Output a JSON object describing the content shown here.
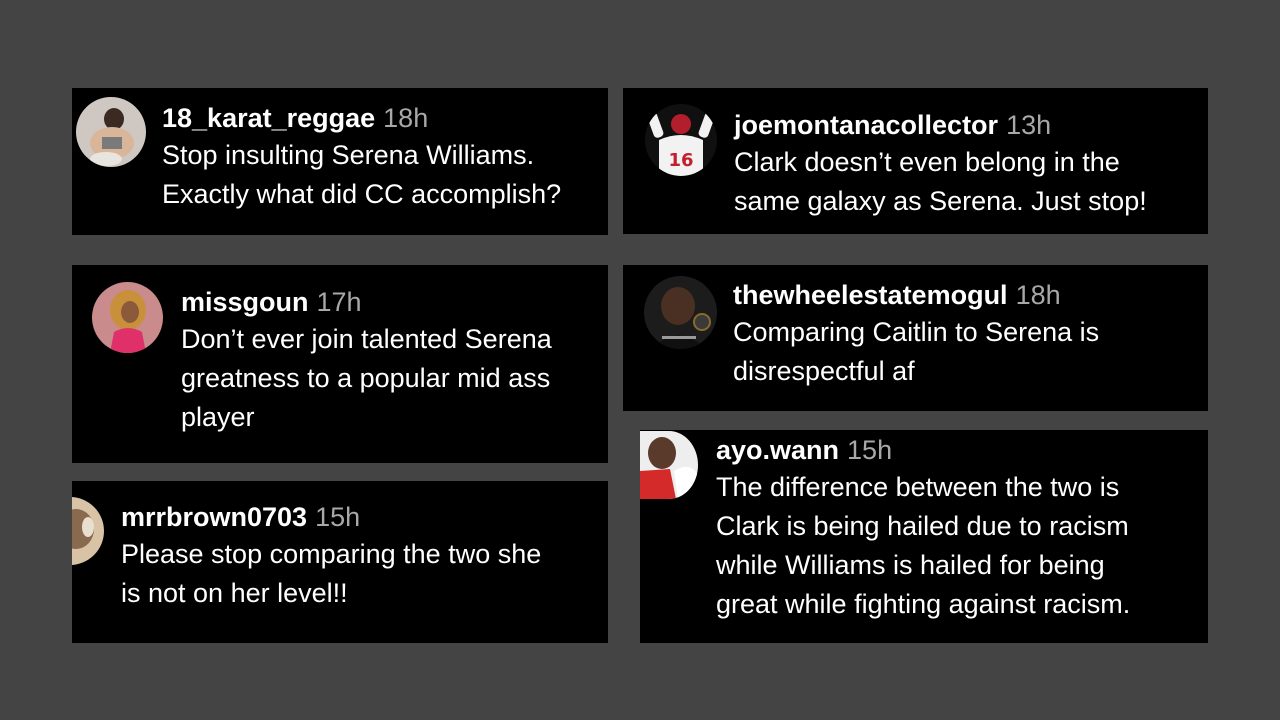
{
  "comments": [
    {
      "username": "18_karat_reggae",
      "time": "18h",
      "text": "Stop insulting Serena Williams.\nExactly what did CC accomplish?"
    },
    {
      "username": "joemontanacollector",
      "time": "13h",
      "text": "Clark doesn’t even belong in the\nsame galaxy as Serena. Just stop!",
      "avatar_jersey": "16"
    },
    {
      "username": "missgoun",
      "time": "17h",
      "text": "Don’t ever join talented Serena\ngreatness to a popular mid ass\nplayer"
    },
    {
      "username": "thewheelestatemogul",
      "time": "18h",
      "text": "Comparing Caitlin to Serena is\ndisrespectful af"
    },
    {
      "username": "mrrbrown0703",
      "time": "15h",
      "text": "Please stop comparing the two she\nis not on her level!!"
    },
    {
      "username": "ayo.wann",
      "time": "15h",
      "text": "The difference between the two is\nClark is being hailed due to racism\nwhile Williams is hailed for being\ngreat while fighting against racism."
    }
  ]
}
